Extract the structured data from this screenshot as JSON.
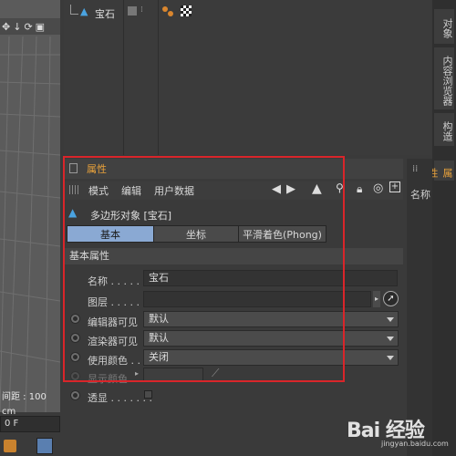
{
  "viewport": {
    "toolbar_icons": [
      "move-icon",
      "arrow-down-icon",
      "rotate-icon",
      "frame-icon"
    ],
    "distance_label": "间距 : 100 cm"
  },
  "timeline": {
    "frame_value": "0 F"
  },
  "object_manager": {
    "object_name": "宝石"
  },
  "right_tabs": [
    "对象",
    "内容浏览器",
    "构造",
    "属性"
  ],
  "attributes": {
    "title": "属性",
    "menu": [
      "模式",
      "编辑",
      "用户数据"
    ],
    "object_type": "多边形对象 [宝石]",
    "tabs": [
      "基本",
      "坐标",
      "平滑着色(Phong)"
    ],
    "section": "基本属性",
    "props": {
      "name_label": "名称 . . . . . . .",
      "name_value": "宝石",
      "layer_label": "图层 . . . . . . .",
      "editor_visible_label": "编辑器可见",
      "editor_visible_value": "默认",
      "render_visible_label": "渲染器可见",
      "render_visible_value": "默认",
      "use_color_label": "使用颜色 . .",
      "use_color_value": "关闭",
      "display_color_label": "显示颜色",
      "xray_label": "透显 . . . . . . ."
    }
  },
  "side_panel": {
    "name_label": "名称"
  },
  "watermark": {
    "text": "Bai 经验",
    "sub": "jingyan.baidu.com"
  },
  "colors": {
    "accent": "#e9a23b",
    "active_tab": "#8aa9d3",
    "highlight_frame": "#d9252a"
  }
}
